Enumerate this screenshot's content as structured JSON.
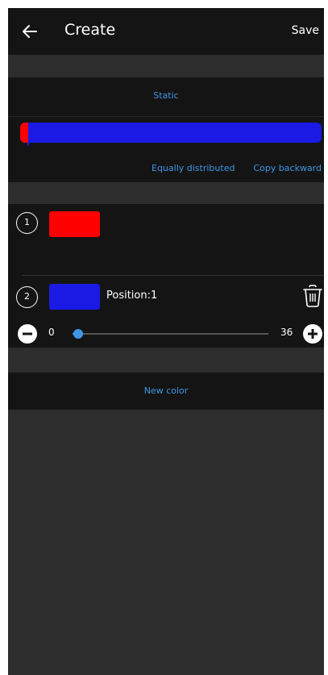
{
  "header": {
    "title": "Create",
    "save_label": "Save",
    "back_icon": "arrow-left-icon"
  },
  "gradient": {
    "mode_label": "Static",
    "equally_distributed_label": "Equally distributed",
    "copy_backward_label": "Copy backward"
  },
  "colors": [
    {
      "index": "1",
      "swatch_color": "#ff0000"
    },
    {
      "index": "2",
      "swatch_color": "#1a1ae4",
      "position_label": "Position:1",
      "delete_icon": "trash-icon"
    }
  ],
  "slider": {
    "min_label": "0",
    "max_label": "36",
    "value": 1,
    "min": 0,
    "max": 36,
    "decrease_icon": "minus-circle-icon",
    "increase_icon": "plus-circle-icon"
  },
  "new_color_label": "New color",
  "theme": {
    "background": "#2d2d2d",
    "card": "#141414",
    "accent": "#3e96e6"
  }
}
